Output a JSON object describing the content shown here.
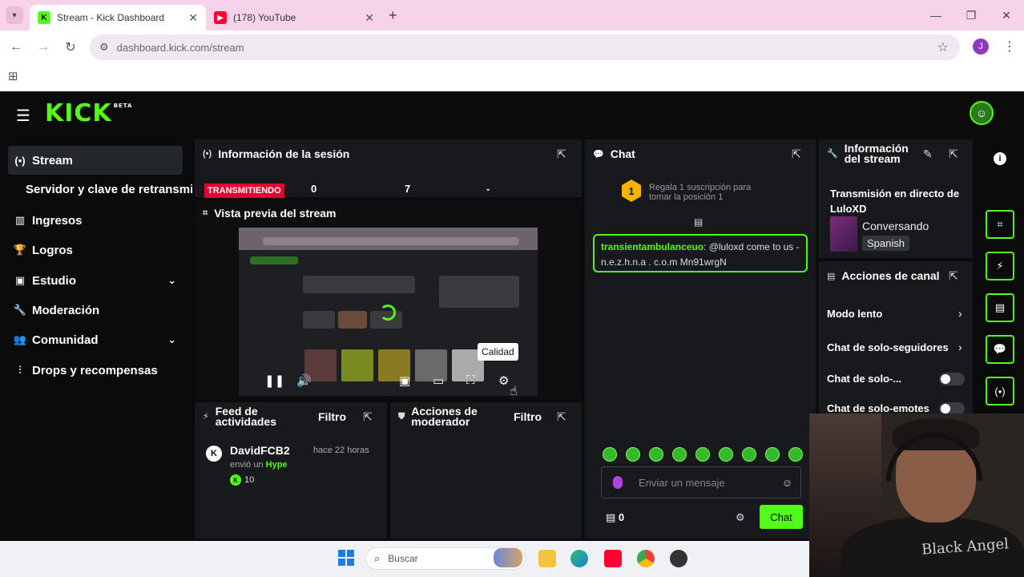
{
  "browser": {
    "tabs": [
      {
        "title": "Stream - Kick Dashboard",
        "active": true
      },
      {
        "title": "(178) YouTube",
        "active": false
      }
    ],
    "new_tab": "+",
    "url": "dashboard.kick.com/stream",
    "profile_initial": "J"
  },
  "app": {
    "logo": "KICK",
    "logo_tag": "BETA"
  },
  "sidebar": {
    "items": [
      {
        "label": "Stream",
        "icon": "live-signal-icon",
        "active": true
      },
      {
        "label": "Servidor y clave de retransmisión"
      },
      {
        "label": "Ingresos",
        "icon": "chart-icon"
      },
      {
        "label": "Logros",
        "icon": "trophy-icon"
      },
      {
        "label": "Estudio",
        "icon": "studio-icon",
        "expandable": true
      },
      {
        "label": "Moderación",
        "icon": "wrench-icon"
      },
      {
        "label": "Comunidad",
        "icon": "people-icon",
        "expandable": true
      },
      {
        "label": "Drops y recompensas",
        "icon": "drops-icon"
      }
    ]
  },
  "session": {
    "title": "Información de la sesión",
    "status": "TRANSMITIENDO",
    "stats": [
      "0",
      "7",
      "-"
    ]
  },
  "preview": {
    "title": "Vista previa del stream",
    "tooltip": "Calidad"
  },
  "feed": {
    "title": "Feed de actividades",
    "filter": "Filtro",
    "items": [
      {
        "user": "DavidFCB2",
        "time": "hace 22 horas",
        "action_prefix": "envió un",
        "action": "Hype",
        "points": "10"
      }
    ]
  },
  "mod_actions": {
    "title": "Acciones de moderador",
    "filter": "Filtro"
  },
  "chat": {
    "title": "Chat",
    "gift_rank": "1",
    "gift_text": "Regala 1 suscripción para tomar la posición 1",
    "messages": [
      {
        "user": "transientambulanceuo",
        "text": ": @luloxd come to us - n.e.z.h.n.a . c.o.m Mn91wrgN"
      }
    ],
    "input_placeholder": "Enviar un mensaje",
    "count": "0",
    "send_label": "Chat",
    "accent": "#53fc18"
  },
  "stream_info": {
    "title": "Información del stream",
    "stream_title": "Transmisión en directo de LuloXD",
    "category": "Conversando",
    "language": "Spanish"
  },
  "channel_actions": {
    "title": "Acciones de canal",
    "options": [
      {
        "label": "Modo lento",
        "kind": "chevron"
      },
      {
        "label": "Chat de solo-seguidores",
        "kind": "chevron"
      },
      {
        "label": "Chat de solo-...",
        "kind": "toggle"
      },
      {
        "label": "Chat de solo-emotes",
        "kind": "toggle"
      }
    ]
  },
  "taskbar": {
    "search": "Buscar"
  },
  "webcam": {
    "shirt_text": "Black Angel"
  }
}
